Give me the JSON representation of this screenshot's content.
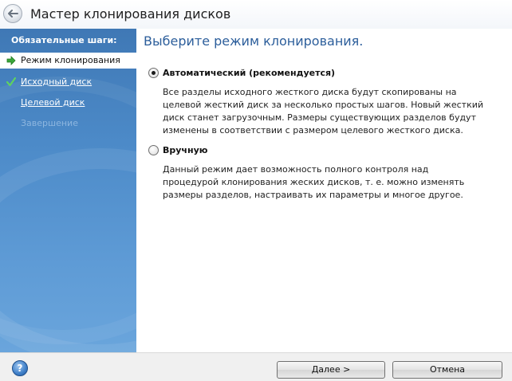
{
  "window": {
    "title": "Мастер клонирования дисков",
    "back_icon": "back-arrow-icon"
  },
  "sidebar": {
    "heading": "Обязательные шаги:",
    "items": [
      {
        "label": "Режим клонирования",
        "state": "current",
        "icon": "arrow-right-icon"
      },
      {
        "label": "Исходный диск",
        "state": "done",
        "icon": "checkmark-icon"
      },
      {
        "label": "Целевой диск",
        "state": "next"
      },
      {
        "label": "Завершение",
        "state": "disabled"
      }
    ]
  },
  "main": {
    "heading": "Выберите режим клонирования.",
    "options": [
      {
        "label": "Автоматический (рекомендуется)",
        "selected": true,
        "description": "Все разделы исходного жесткого диска будут скопированы на целевой жесткий диск за несколько простых шагов. Новый жесткий диск станет загрузочным. Размеры существующих разделов будут изменены в соответствии с размером целевого жесткого диска."
      },
      {
        "label": "Вручную",
        "selected": false,
        "description": "Данный режим дает возможность полного контроля над процедурой клонирования жеских дисков, т. е. можно изменять размеры разделов, настраивать их параметры и многое другое."
      }
    ]
  },
  "footer": {
    "help_icon": "help-icon",
    "help_glyph": "?",
    "next_label": "Далее >",
    "cancel_label": "Отмена"
  },
  "colors": {
    "sidebar_blue": "#4c8ac8",
    "heading_blue": "#2c5e9b",
    "check_green": "#3aa63a"
  }
}
